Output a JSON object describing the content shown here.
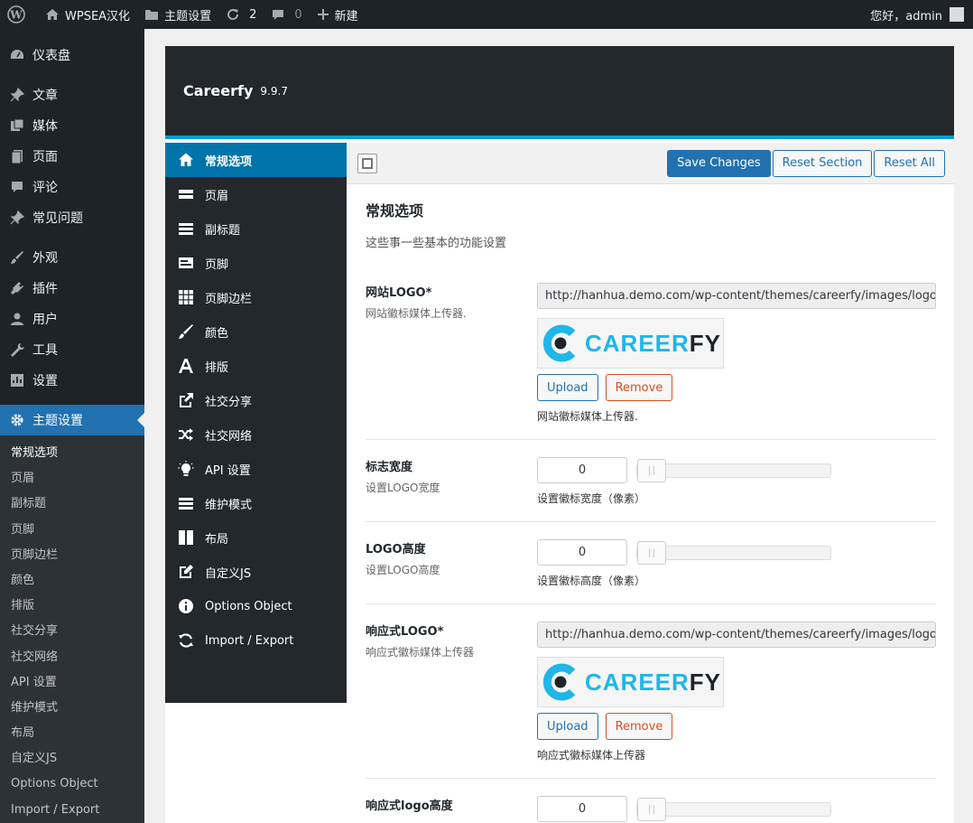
{
  "adminbar": {
    "site_name": "WPSEA汉化",
    "theme_settings": "主题设置",
    "updates_count": "2",
    "comments_count": "0",
    "new_label": "新建",
    "greeting": "您好，admin"
  },
  "adminmenu": {
    "items": [
      {
        "label": "仪表盘",
        "icon": "dashboard-icon"
      },
      {
        "label": "文章",
        "icon": "pin-icon"
      },
      {
        "label": "媒体",
        "icon": "media-icon"
      },
      {
        "label": "页面",
        "icon": "page-icon"
      },
      {
        "label": "评论",
        "icon": "comment-icon"
      },
      {
        "label": "常见问题",
        "icon": "pin-icon"
      },
      {
        "label": "外观",
        "icon": "brush-icon"
      },
      {
        "label": "插件",
        "icon": "plugin-icon"
      },
      {
        "label": "用户",
        "icon": "user-icon"
      },
      {
        "label": "工具",
        "icon": "wrench-icon"
      },
      {
        "label": "设置",
        "icon": "settings-icon"
      },
      {
        "label": "主题设置",
        "icon": "gear-icon"
      }
    ],
    "sub_items": [
      "常规选项",
      "页眉",
      "副标题",
      "页脚",
      "页脚边栏",
      "颜色",
      "排版",
      "社交分享",
      "社交网络",
      "API 设置",
      "维护模式",
      "布局",
      "自定义JS",
      "Options Object",
      "Import / Export"
    ]
  },
  "panel": {
    "title": "Careerfy",
    "version": "9.9.7",
    "sidebar": [
      {
        "label": "常规选项",
        "icon": "home-icon"
      },
      {
        "label": "页眉",
        "icon": "header-icon"
      },
      {
        "label": "副标题",
        "icon": "list-icon"
      },
      {
        "label": "页脚",
        "icon": "footer-icon"
      },
      {
        "label": "页脚边栏",
        "icon": "grid-icon"
      },
      {
        "label": "颜色",
        "icon": "brush-icon"
      },
      {
        "label": "排版",
        "icon": "font-icon"
      },
      {
        "label": "社交分享",
        "icon": "share-icon"
      },
      {
        "label": "社交网络",
        "icon": "shuffle-icon"
      },
      {
        "label": "API 设置",
        "icon": "lightbulb-icon"
      },
      {
        "label": "维护模式",
        "icon": "list-icon"
      },
      {
        "label": "布局",
        "icon": "columns-icon"
      },
      {
        "label": "自定义JS",
        "icon": "edit-icon"
      },
      {
        "label": "Options Object",
        "icon": "info-icon"
      },
      {
        "label": "Import / Export",
        "icon": "refresh-icon"
      }
    ],
    "toolbar": {
      "save": "Save Changes",
      "reset_section": "Reset Section",
      "reset_all": "Reset All"
    },
    "section": {
      "title": "常规选项",
      "desc": "这些事一些基本的功能设置"
    },
    "fields": {
      "logo": {
        "title": "网站LOGO*",
        "sub": "网站徽标媒体上传器.",
        "url": "http://hanhua.demo.com/wp-content/themes/careerfy/images/logo.png",
        "logo_text_a": "CAREER",
        "logo_text_b": "FY",
        "upload": "Upload",
        "remove": "Remove",
        "help": "网站徽标媒体上传器."
      },
      "logo_width": {
        "title": "标志宽度",
        "sub": "设置LOGO宽度",
        "value": "0",
        "help": "设置徽标宽度（像素）"
      },
      "logo_height": {
        "title": "LOGO高度",
        "sub": "设置LOGO高度",
        "value": "0",
        "help": "设置徽标高度（像素）"
      },
      "resp_logo": {
        "title": "响应式LOGO*",
        "sub": "响应式徽标媒体上传器",
        "url": "http://hanhua.demo.com/wp-content/themes/careerfy/images/logo.png",
        "logo_text_a": "CAREER",
        "logo_text_b": "FY",
        "upload": "Upload",
        "remove": "Remove",
        "help": "响应式徽标媒体上传器"
      },
      "resp_logo_height": {
        "title": "响应式logo高度",
        "value": "0"
      }
    }
  }
}
